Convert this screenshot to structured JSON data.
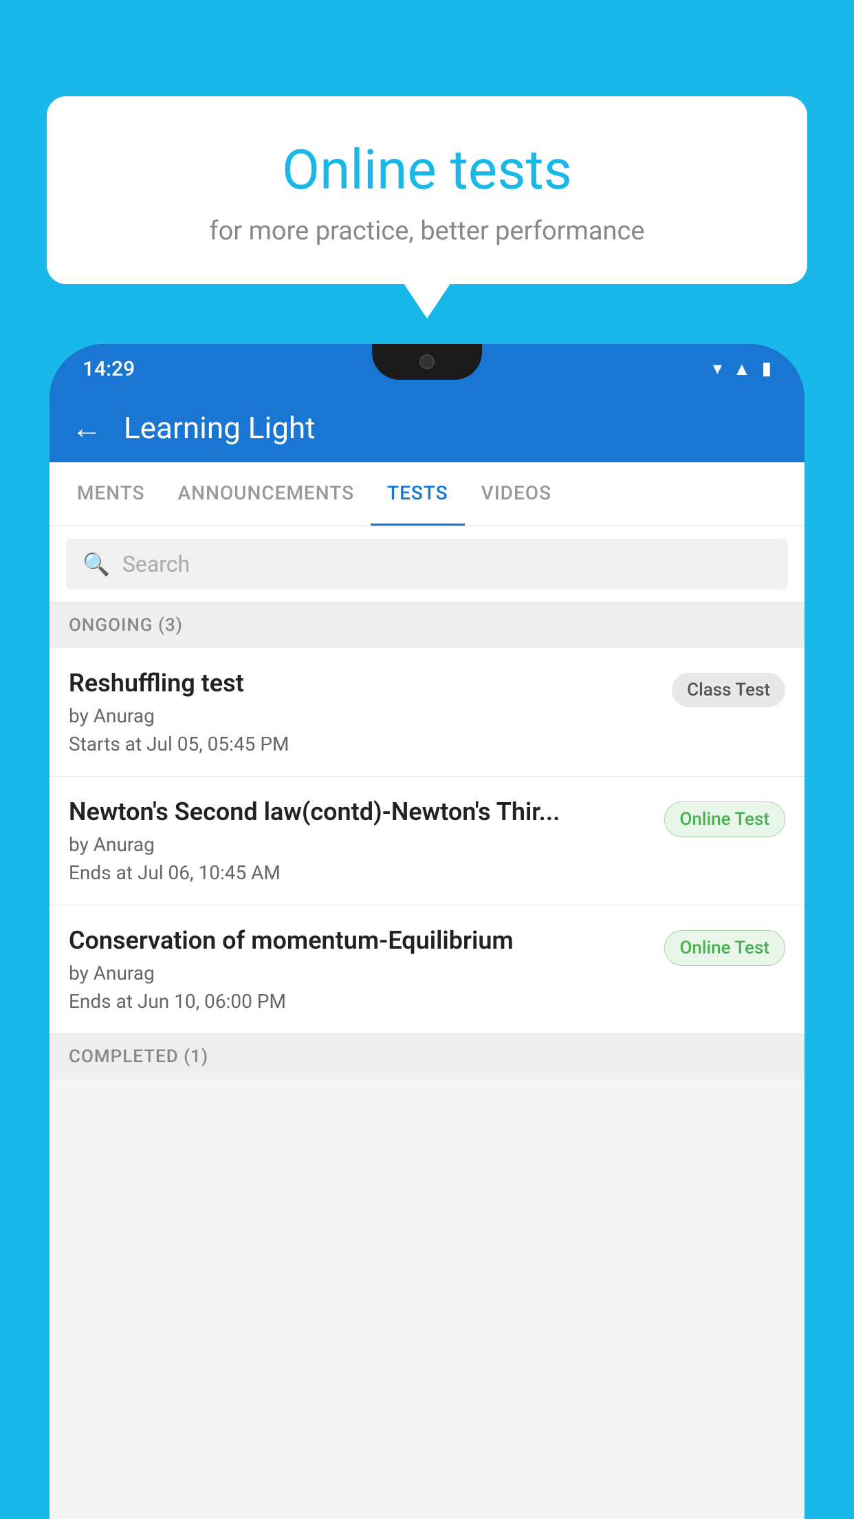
{
  "background_color": "#1ab8e8",
  "bubble": {
    "title": "Online tests",
    "subtitle": "for more practice, better performance"
  },
  "status_bar": {
    "time": "14:29",
    "icons": [
      "wifi",
      "signal",
      "battery"
    ]
  },
  "app_header": {
    "title": "Learning Light",
    "back_label": "←"
  },
  "tabs": [
    {
      "label": "MENTS",
      "active": false
    },
    {
      "label": "ANNOUNCEMENTS",
      "active": false
    },
    {
      "label": "TESTS",
      "active": true
    },
    {
      "label": "VIDEOS",
      "active": false
    }
  ],
  "search": {
    "placeholder": "Search"
  },
  "ongoing_section": {
    "label": "ONGOING (3)"
  },
  "tests": [
    {
      "title": "Reshuffling test",
      "author": "by Anurag",
      "date": "Starts at  Jul 05, 05:45 PM",
      "badge": "Class Test",
      "badge_type": "class"
    },
    {
      "title": "Newton's Second law(contd)-Newton's Thir...",
      "author": "by Anurag",
      "date": "Ends at  Jul 06, 10:45 AM",
      "badge": "Online Test",
      "badge_type": "online"
    },
    {
      "title": "Conservation of momentum-Equilibrium",
      "author": "by Anurag",
      "date": "Ends at  Jun 10, 06:00 PM",
      "badge": "Online Test",
      "badge_type": "online"
    }
  ],
  "completed_section": {
    "label": "COMPLETED (1)"
  }
}
